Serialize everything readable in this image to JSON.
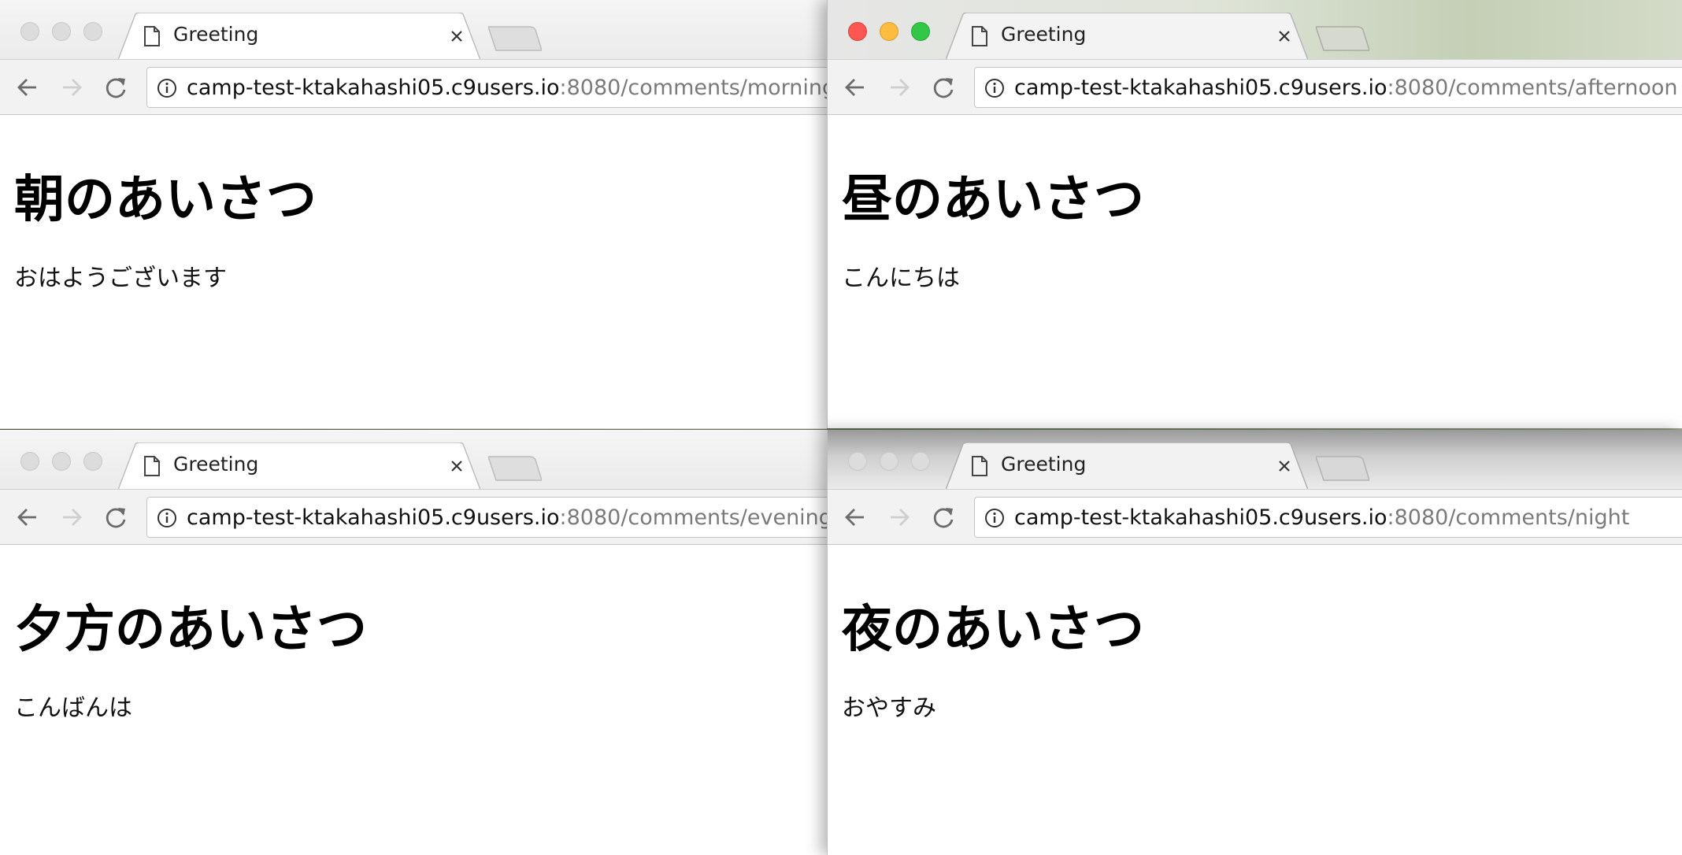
{
  "windows": [
    {
      "id": "win-tl",
      "tab_title": "Greeting",
      "url_host": "camp-test-ktakahashi05.c9users.io",
      "url_path": ":8080/comments/morning",
      "heading": "朝のあいさつ",
      "message": "おはようございます",
      "active": false
    },
    {
      "id": "win-tr",
      "tab_title": "Greeting",
      "url_host": "camp-test-ktakahashi05.c9users.io",
      "url_path": ":8080/comments/afternoon",
      "heading": "昼のあいさつ",
      "message": "こんにちは",
      "active": true
    },
    {
      "id": "win-bl",
      "tab_title": "Greeting",
      "url_host": "camp-test-ktakahashi05.c9users.io",
      "url_path": ":8080/comments/evening",
      "heading": "夕方のあいさつ",
      "message": "こんばんは",
      "active": false
    },
    {
      "id": "win-br",
      "tab_title": "Greeting",
      "url_host": "camp-test-ktakahashi05.c9users.io",
      "url_path": ":8080/comments/night",
      "heading": "夜のあいさつ",
      "message": "おやすみ",
      "active": false
    }
  ],
  "icons": {
    "favicon": "page-icon",
    "close": "close-icon",
    "back": "arrow-left-icon",
    "forward": "arrow-right-icon",
    "reload": "reload-icon",
    "info": "info-icon"
  },
  "colors": {
    "close_light": "#fc5753",
    "minimize_light": "#fdbc40",
    "zoom_light": "#33c748",
    "inactive_light": "#dcdcdc",
    "url_path": "#7a7a7a"
  }
}
